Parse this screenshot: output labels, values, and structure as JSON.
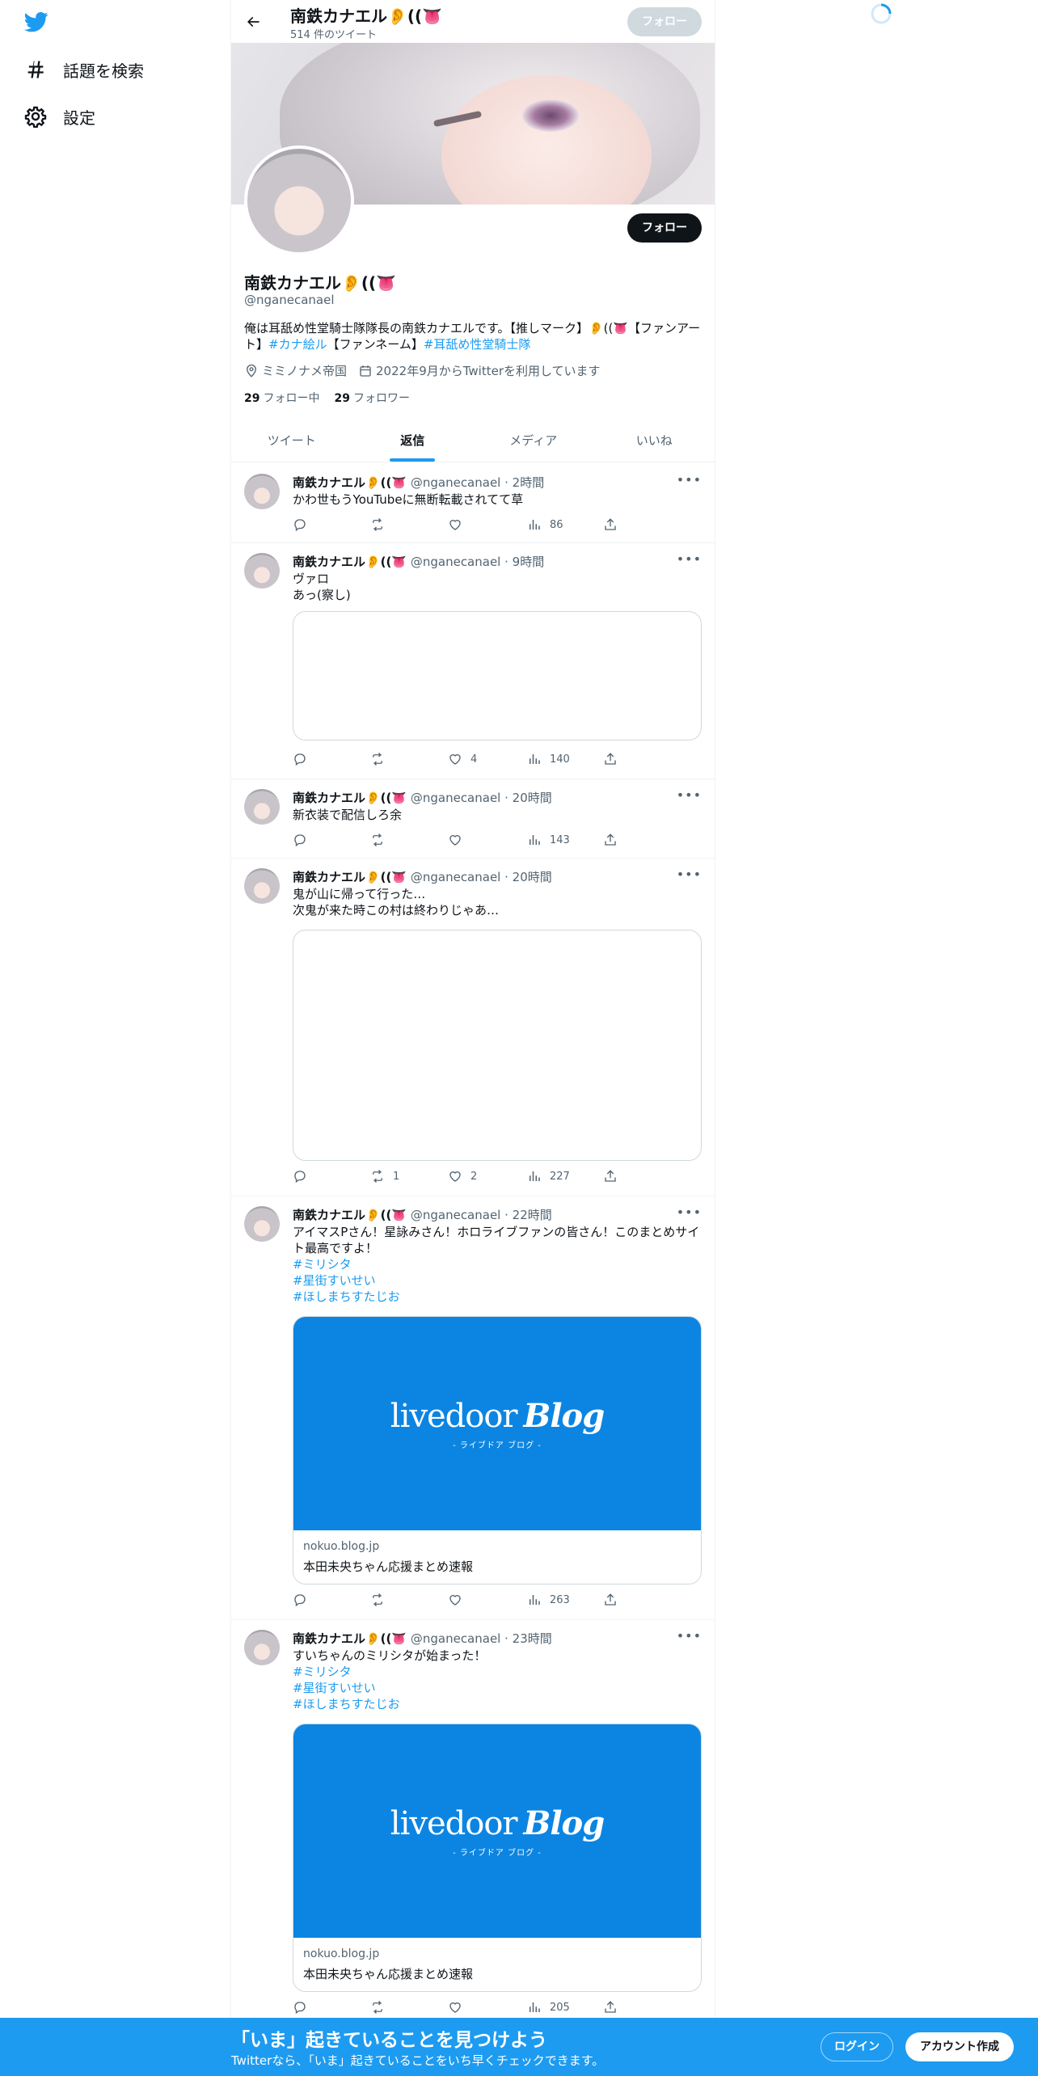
{
  "nav": {
    "logo_icon": "twitter-bird-icon",
    "explore_label": "話題を検索",
    "settings_label": "設定"
  },
  "header": {
    "name": "南鉄カナエル👂((👅",
    "tweet_count": "514 件のツイート",
    "follow_label": "フォロー"
  },
  "profile": {
    "name": "南鉄カナエル👂((👅",
    "handle": "@nganecanael",
    "follow_label": "フォロー",
    "bio_text": "俺は耳舐め性堂騎士隊隊長の南鉄カナエルです。【推しマーク】👂((👅【ファンアート】",
    "bio_tag1": "#カナ絵ル",
    "bio_mid": "【ファンネーム】",
    "bio_tag2": "#耳舐め性堂騎士隊",
    "location": "ミミノナメ帝国",
    "joined": "2022年9月からTwitterを利用しています",
    "following_count": "29",
    "following_label": "フォロー中",
    "followers_count": "29",
    "followers_label": "フォロワー"
  },
  "tabs": [
    {
      "label": "ツイート",
      "active": false
    },
    {
      "label": "返信",
      "active": true
    },
    {
      "label": "メディア",
      "active": false
    },
    {
      "label": "いいね",
      "active": false
    }
  ],
  "tweets": [
    {
      "name": "南鉄カナエル👂((👅",
      "handle": "@nganecanael",
      "time": "· 2時間",
      "text": "かわ世もうYouTubeに無断転載されてて草",
      "tags": [],
      "replies": "",
      "retweets": "",
      "likes": "",
      "views": "86"
    },
    {
      "name": "南鉄カナエル👂((👅",
      "handle": "@nganecanael",
      "time": "· 9時間",
      "text": "ヴァロ\nあっ(察し)",
      "tags": [],
      "replies": "",
      "retweets": "",
      "likes": "4",
      "views": "140"
    },
    {
      "name": "南鉄カナエル👂((👅",
      "handle": "@nganecanael",
      "time": "· 20時間",
      "text": "新衣装で配信しろ余",
      "tags": [],
      "replies": "",
      "retweets": "",
      "likes": "",
      "views": "143"
    },
    {
      "name": "南鉄カナエル👂((👅",
      "handle": "@nganecanael",
      "time": "· 20時間",
      "text": "鬼が山に帰って行った…\n次鬼が来た時この村は終わりじゃあ…",
      "tags": [],
      "replies": "",
      "retweets": "1",
      "likes": "2",
      "views": "227"
    },
    {
      "name": "南鉄カナエル👂((👅",
      "handle": "@nganecanael",
      "time": "· 22時間",
      "text": "アイマスPさん！星詠みさん！ホロライブファンの皆さん！このまとめサイト最高ですよ！",
      "tags": [
        "#ミリシタ",
        "#星街すいせい",
        "#ほしまちすたじお"
      ],
      "card": {
        "brand": "livedoor",
        "brand2": "Blog",
        "sub": "- ライブドア ブログ -",
        "domain": "nokuo.blog.jp",
        "title": "本田未央ちゃん応援まとめ速報"
      },
      "replies": "",
      "retweets": "",
      "likes": "",
      "views": "263"
    },
    {
      "name": "南鉄カナエル👂((👅",
      "handle": "@nganecanael",
      "time": "· 23時間",
      "text": "すいちゃんのミリシタが始まった！",
      "tags": [
        "#ミリシタ",
        "#星街すいせい",
        "#ほしまちすたじお"
      ],
      "card": {
        "brand": "livedoor",
        "brand2": "Blog",
        "sub": "- ライブドア ブログ -",
        "domain": "nokuo.blog.jp",
        "title": "本田未央ちゃん応援まとめ速報"
      },
      "replies": "",
      "retweets": "",
      "likes": "",
      "views": "205"
    }
  ],
  "bottom_bar": {
    "title": "「いま」起きていることを見つけよう",
    "subtitle": "Twitterなら、「いま」起きていることをいち早くチェックできます。",
    "login_label": "ログイン",
    "signup_label": "アカウント作成"
  },
  "colors": {
    "accent": "#1d9bf0",
    "text": "#0f1419",
    "muted": "#536471",
    "card_blue": "#0c85e2"
  }
}
